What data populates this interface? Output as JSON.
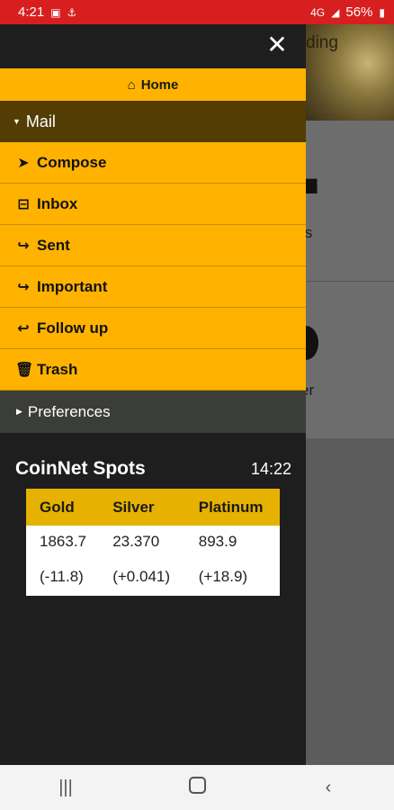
{
  "status_bar": {
    "time": "4:21",
    "network": "4G",
    "battery": "56%"
  },
  "background": {
    "banner_text": "ding",
    "text1": "ts",
    "text2": "er"
  },
  "drawer": {
    "home": {
      "icon": "home-icon",
      "label": "Home"
    },
    "mail_section": {
      "label": "Mail",
      "expanded": true
    },
    "mail_items": [
      {
        "icon": "paper-plane-icon",
        "label": "Compose"
      },
      {
        "icon": "inbox-icon",
        "label": "Inbox"
      },
      {
        "icon": "share-icon",
        "label": "Sent"
      },
      {
        "icon": "share-icon",
        "label": "Important"
      },
      {
        "icon": "reply-icon",
        "label": "Follow up"
      },
      {
        "icon": "trash-icon",
        "label": "Trash"
      }
    ],
    "preferences": {
      "label": "Preferences",
      "expanded": false
    }
  },
  "spots": {
    "title": "CoinNet Spots",
    "time": "14:22",
    "columns": [
      "Gold",
      "Silver",
      "Platinum"
    ],
    "prices": [
      "1863.7",
      "23.370",
      "893.9"
    ],
    "changes": [
      "(-11.8)",
      "(+0.041)",
      "(+18.9)"
    ],
    "colors": {
      "negative": "#d9534f",
      "positive": "#2ea043",
      "accent": "#ffb300"
    }
  }
}
